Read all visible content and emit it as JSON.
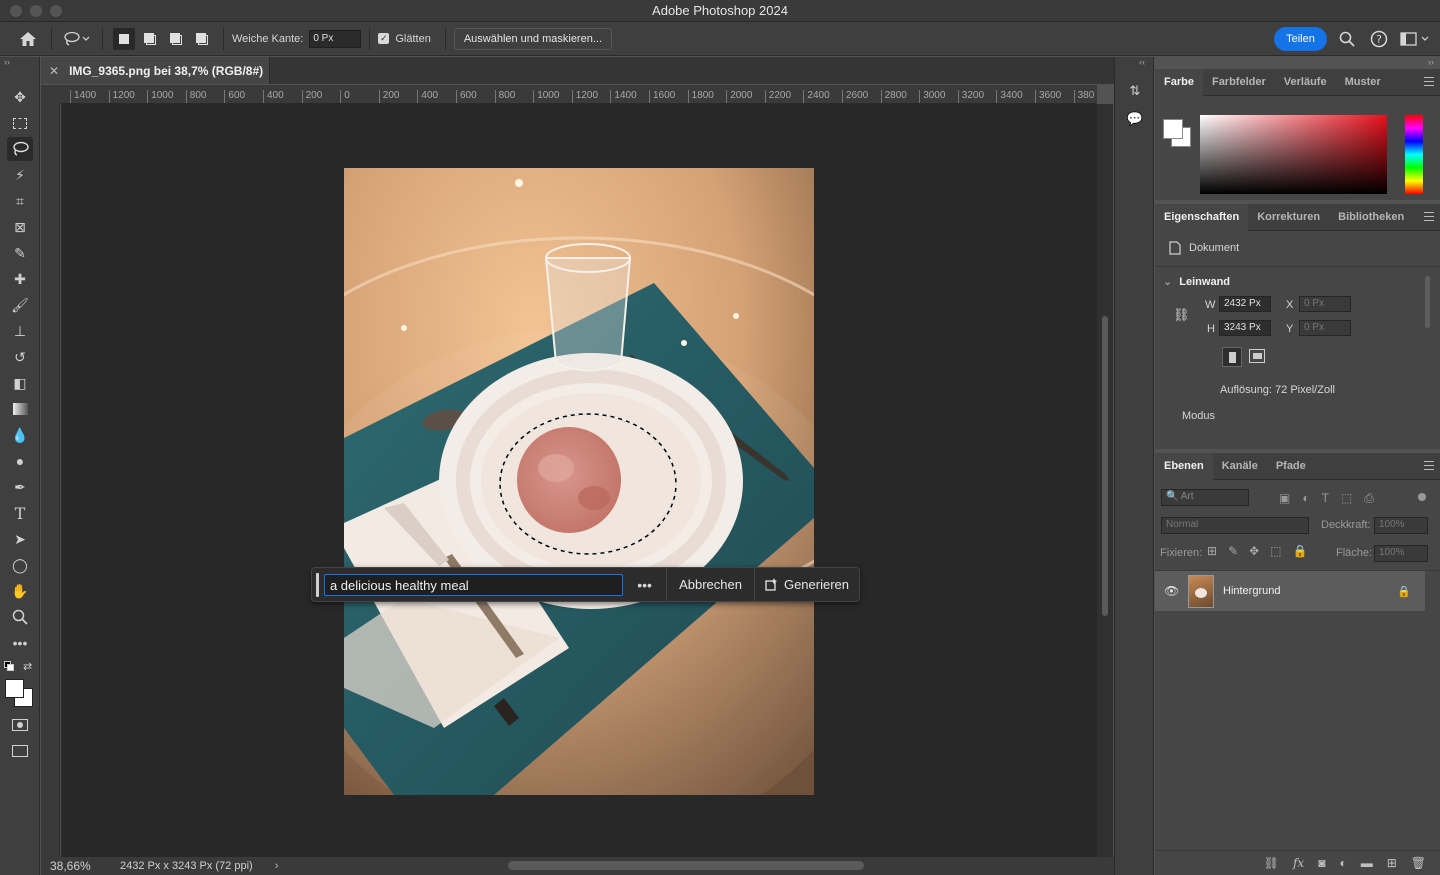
{
  "window": {
    "title": "Adobe Photoshop 2024"
  },
  "options": {
    "feather_label": "Weiche Kante:",
    "feather_value": "0 Px",
    "antialias_label": "Glätten",
    "select_mask_label": "Auswählen und maskieren...",
    "share_label": "Teilen"
  },
  "document": {
    "tab_title": "IMG_9365.png bei 38,7% (RGB/8#)",
    "zoom": "38,66%",
    "size_info": "2432 Px x 3243 Px (72 ppi)",
    "ruler_ticks": [
      "1400",
      "1200",
      "1000",
      "800",
      "600",
      "400",
      "200",
      "0",
      "200",
      "400",
      "600",
      "800",
      "1000",
      "1200",
      "1400",
      "1600",
      "1800",
      "2000",
      "2200",
      "2400",
      "2600",
      "2800",
      "3000",
      "3200",
      "3400",
      "3600",
      "380"
    ]
  },
  "genfill": {
    "prompt": "a delicious healthy meal",
    "more": "•••",
    "cancel": "Abbrechen",
    "generate": "Generieren"
  },
  "color_panel": {
    "tabs": [
      "Farbe",
      "Farbfelder",
      "Verläufe",
      "Muster"
    ],
    "fg_color": "#ffffff",
    "bg_color": "#ffffff"
  },
  "properties_panel": {
    "tabs": [
      "Eigenschaften",
      "Korrekturen",
      "Bibliotheken"
    ],
    "doc_label": "Dokument",
    "section": "Leinwand",
    "w_label": "W",
    "w_value": "2432 Px",
    "h_label": "H",
    "h_value": "3243 Px",
    "x_label": "X",
    "x_value": "0 Px",
    "y_label": "Y",
    "y_value": "0 Px",
    "resolution": "Auflösung: 72 Pixel/Zoll",
    "mode_label": "Modus"
  },
  "layers_panel": {
    "tabs": [
      "Ebenen",
      "Kanäle",
      "Pfade"
    ],
    "filter_placeholder": "Art",
    "blend_mode": "Normal",
    "opacity_label": "Deckkraft:",
    "opacity_value": "100%",
    "lock_label": "Fixieren:",
    "fill_label": "Fläche:",
    "fill_value": "100%",
    "layers": [
      {
        "name": "Hintergrund"
      }
    ]
  }
}
